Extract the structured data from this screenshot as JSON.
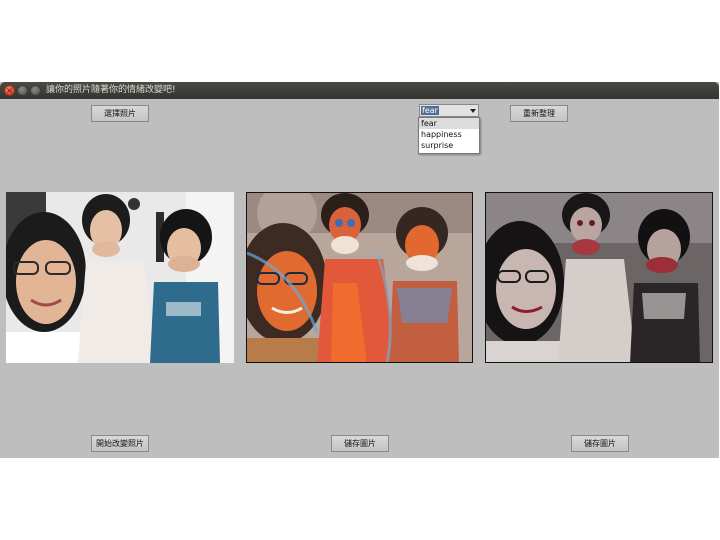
{
  "window": {
    "title": "讓你的照片隨著你的情緒改變吧!",
    "controls": {
      "close": "×"
    }
  },
  "buttons": {
    "select_photo": "選擇照片",
    "refresh": "重新整理",
    "start_change": "開始改變照片",
    "save_image_1": "儲存圖片",
    "save_image_2": "儲存圖片"
  },
  "emotion_select": {
    "value": "fear",
    "options": [
      "fear",
      "happiness",
      "surprise"
    ]
  },
  "images": {
    "original": "original photo",
    "styled_1": "colorful styled photo",
    "styled_2": "dark styled photo"
  },
  "colors": {
    "window_bg": "#bebebe",
    "titlebar": "#3c3b37",
    "selection": "#4d6e96"
  }
}
